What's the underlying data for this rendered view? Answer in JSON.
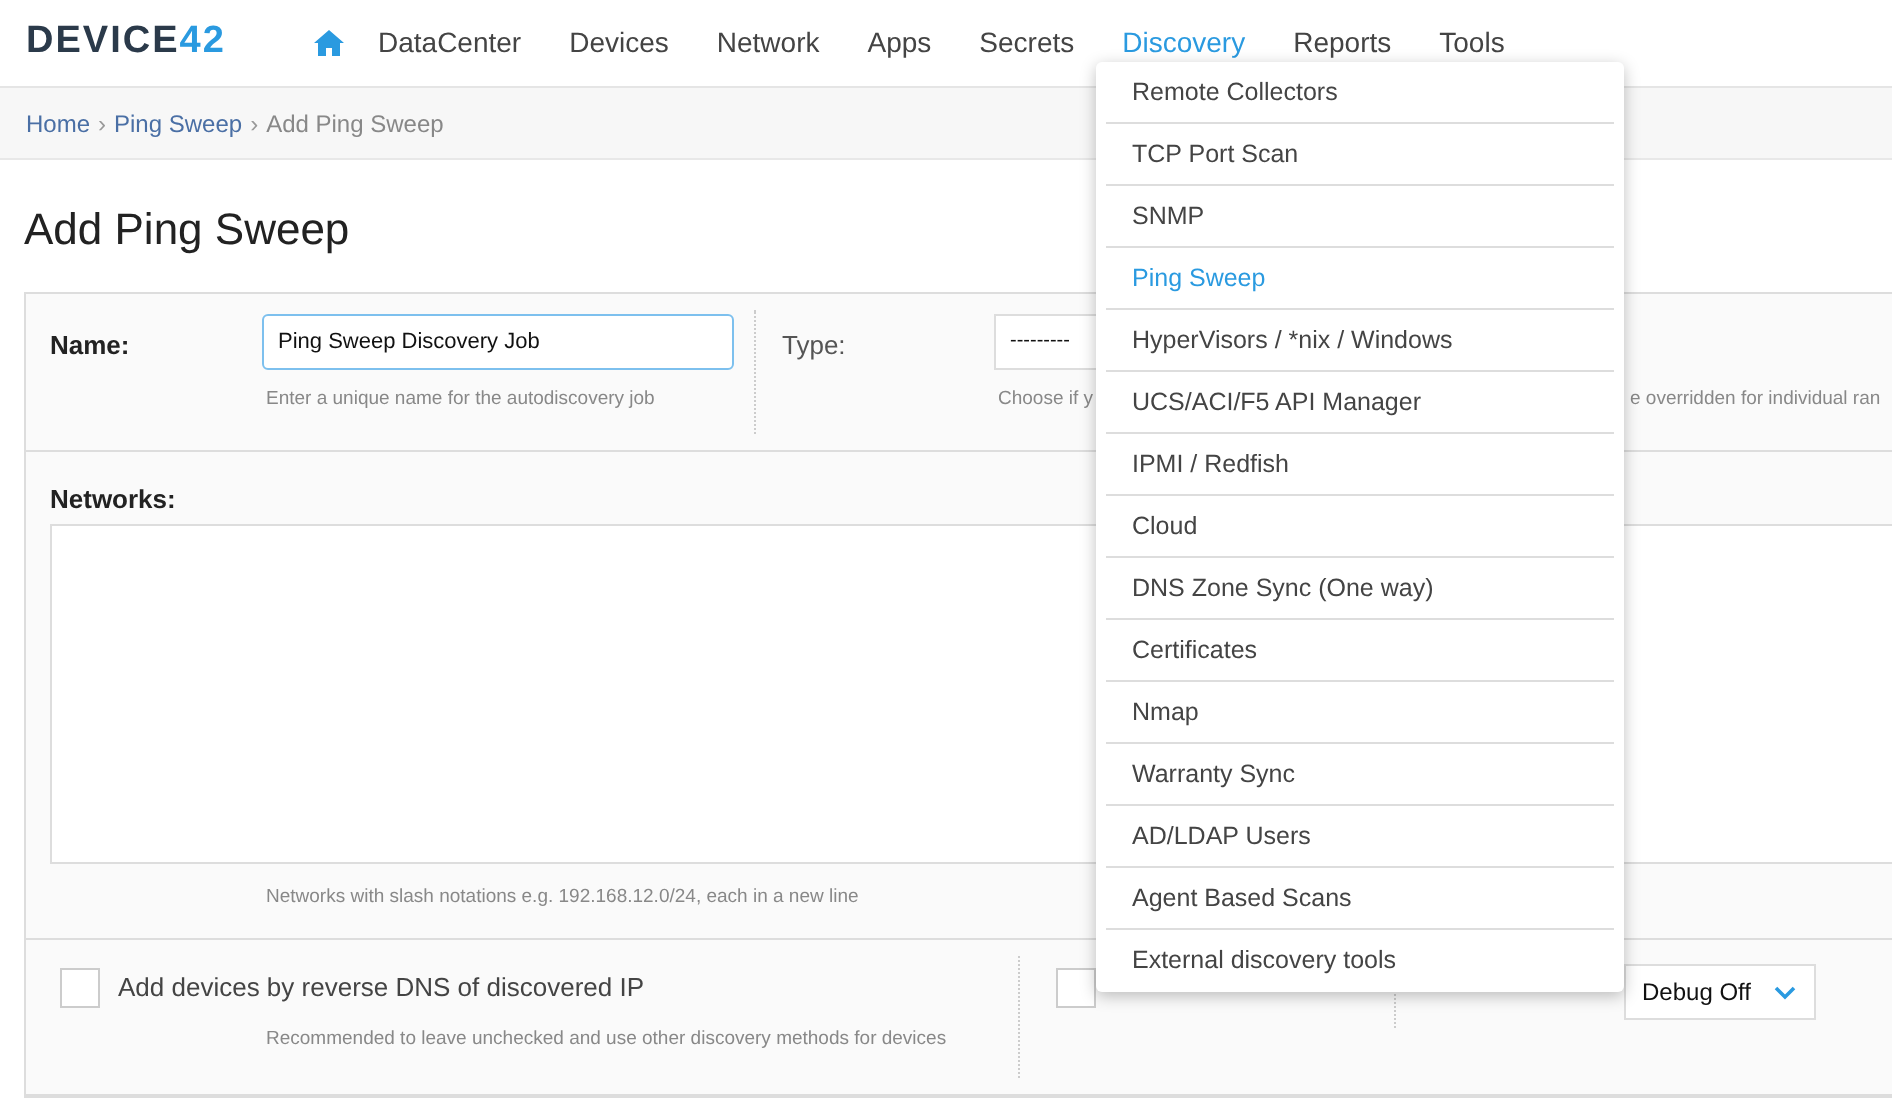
{
  "logo": {
    "text": "DEVICE",
    "accent": "42"
  },
  "nav": [
    {
      "label": "DataCenter",
      "selected": false
    },
    {
      "label": "Devices",
      "selected": false
    },
    {
      "label": "Network",
      "selected": false
    },
    {
      "label": "Apps",
      "selected": false
    },
    {
      "label": "Secrets",
      "selected": false
    },
    {
      "label": "Discovery",
      "selected": true
    },
    {
      "label": "Reports",
      "selected": false
    },
    {
      "label": "Tools",
      "selected": false
    }
  ],
  "breadcrumb": [
    {
      "label": "Home",
      "kind": "link"
    },
    {
      "label": "Ping Sweep",
      "kind": "link"
    },
    {
      "label": "Add Ping Sweep",
      "kind": "current"
    }
  ],
  "breadcrumb_separator": "›",
  "page_title": "Add Ping Sweep",
  "name_field": {
    "label": "Name:",
    "value": "Ping Sweep Discovery Job",
    "hint": "Enter a unique name for the autodiscovery job"
  },
  "type_field": {
    "label": "Type:",
    "value": "---------",
    "hint_parts": [
      "Choose if y",
      "e overridden for individual ran"
    ]
  },
  "networks_field": {
    "label": "Networks:",
    "hint": "Networks with slash notations e.g. 192.168.12.0/24, each in a new line"
  },
  "reverse_dns": {
    "label": "Add devices by reverse DNS of discovered IP",
    "checked": false,
    "hint": "Recommended to leave unchecked and use other discovery methods for devices"
  },
  "strip_domain": {
    "checked": false
  },
  "debug_level": {
    "value": "Debug Off"
  },
  "discovery_menu": [
    {
      "label": "Remote Collectors",
      "selected": false
    },
    {
      "label": "TCP Port Scan",
      "selected": false
    },
    {
      "label": "SNMP",
      "selected": false
    },
    {
      "label": "Ping Sweep",
      "selected": true
    },
    {
      "label": "HyperVisors / *nix / Windows",
      "selected": false
    },
    {
      "label": "UCS/ACI/F5 API Manager",
      "selected": false
    },
    {
      "label": "IPMI / Redfish",
      "selected": false
    },
    {
      "label": "Cloud",
      "selected": false
    },
    {
      "label": "DNS Zone Sync (One way)",
      "selected": false
    },
    {
      "label": "Certificates",
      "selected": false
    },
    {
      "label": "Nmap",
      "selected": false
    },
    {
      "label": "Warranty Sync",
      "selected": false
    },
    {
      "label": "AD/LDAP Users",
      "selected": false
    },
    {
      "label": "Agent Based Scans",
      "selected": false
    },
    {
      "label": "External discovery tools",
      "selected": false
    }
  ]
}
